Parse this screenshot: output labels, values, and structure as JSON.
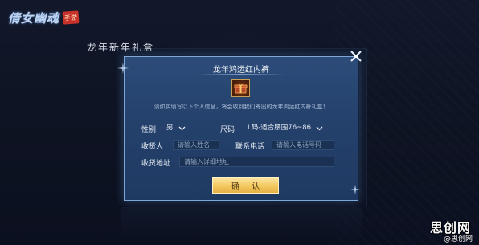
{
  "app": {
    "logo_text": "倩女幽魂",
    "logo_seal": "手游"
  },
  "background": {
    "gift_box_title": "龙年新年礼盒"
  },
  "dialog": {
    "title": "龙年鸿运红内裤",
    "notice": "请如实填写以下个人信息，将会收到我们寄出的龙年鸿运红内裤礼盒！",
    "gender_label": "性别",
    "gender_value": "男",
    "size_label": "尺码",
    "size_value": "L码-适合腰围76~86",
    "recipient_label": "收货人",
    "recipient_placeholder": "请输入姓名",
    "phone_label": "联系电话",
    "phone_placeholder": "请输入电话号码",
    "address_label": "收货地址",
    "address_placeholder": "请输入详细地址",
    "confirm_label": "确 认"
  },
  "watermark": {
    "brand": "思创网",
    "sub": "@思创网"
  },
  "colors": {
    "dialog_bg": "#24416c",
    "dialog_border": "#7fa6d6",
    "confirm_button": "#f3c95e",
    "text_light": "#e6ebf3"
  },
  "icons": {
    "close": "close-icon",
    "gift": "gift-box-icon",
    "chevron": "chevron-down-icon",
    "sparkle": "sparkle-icon"
  }
}
